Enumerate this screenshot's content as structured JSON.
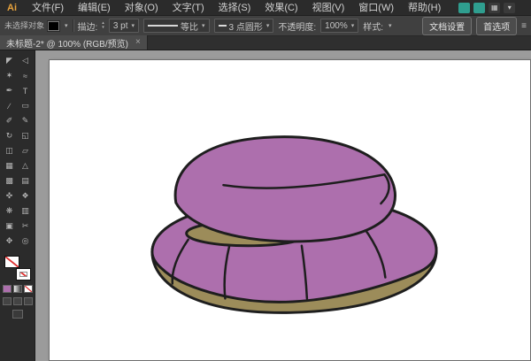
{
  "app": {
    "logo": "Ai"
  },
  "menubar": {
    "items": [
      "文件(F)",
      "编辑(E)",
      "对象(O)",
      "文字(T)",
      "选择(S)",
      "效果(C)",
      "视图(V)",
      "窗口(W)",
      "帮助(H)"
    ],
    "right_icons": [
      {
        "name": "appbar-teal-icon-1",
        "glyph": "",
        "color": "#2f9e8f"
      },
      {
        "name": "appbar-teal-icon-2",
        "glyph": "",
        "color": "#2f9e8f"
      },
      {
        "name": "arrange-documents-icon",
        "glyph": "▦",
        "color": "#3a3a3a"
      },
      {
        "name": "workspace-caret-icon",
        "glyph": "▾",
        "color": "#3a3a3a"
      }
    ]
  },
  "controlbar": {
    "no_selection": "未选择对象",
    "fill_swatch_color": "#000000",
    "stroke_label": "描边:",
    "stroke_value": "3 pt",
    "spinner_up": "▴",
    "spinner_down": "▾",
    "width_profile_label": "等比",
    "brush_label": "3 点圆形",
    "opacity_label": "不透明度:",
    "opacity_value": "100%",
    "style_label": "样式:",
    "caret": "▾",
    "doc_setup_button": "文档设置",
    "preferences_button": "首选项",
    "panel_icon": "≡"
  },
  "tabbar": {
    "title": "未标题-2* @ 100% (RGB/预览)",
    "close": "×"
  },
  "toolbar": {
    "tools": [
      {
        "name": "selection-tool",
        "glyph": "◤"
      },
      {
        "name": "direct-selection-tool",
        "glyph": "◁"
      },
      {
        "name": "magic-wand-tool",
        "glyph": "✶"
      },
      {
        "name": "lasso-tool",
        "glyph": "≈"
      },
      {
        "name": "pen-tool",
        "glyph": "✒"
      },
      {
        "name": "type-tool",
        "glyph": "T"
      },
      {
        "name": "line-segment-tool",
        "glyph": "∕"
      },
      {
        "name": "rectangle-tool",
        "glyph": "▭"
      },
      {
        "name": "paintbrush-tool",
        "glyph": "✐"
      },
      {
        "name": "pencil-tool",
        "glyph": "✎"
      },
      {
        "name": "rotate-tool",
        "glyph": "↻"
      },
      {
        "name": "scale-tool",
        "glyph": "◱"
      },
      {
        "name": "width-tool",
        "glyph": "◫"
      },
      {
        "name": "free-transform-tool",
        "glyph": "▱"
      },
      {
        "name": "shape-builder-tool",
        "glyph": "▦"
      },
      {
        "name": "perspective-grid-tool",
        "glyph": "△"
      },
      {
        "name": "mesh-tool",
        "glyph": "▩"
      },
      {
        "name": "gradient-tool",
        "glyph": "▤"
      },
      {
        "name": "eyedropper-tool",
        "glyph": "✜"
      },
      {
        "name": "blend-tool",
        "glyph": "❖"
      },
      {
        "name": "symbol-sprayer-tool",
        "glyph": "❋"
      },
      {
        "name": "column-graph-tool",
        "glyph": "▥"
      },
      {
        "name": "artboard-tool",
        "glyph": "▣"
      },
      {
        "name": "slice-tool",
        "glyph": "✂"
      },
      {
        "name": "hand-tool",
        "glyph": "✥"
      },
      {
        "name": "zoom-tool",
        "glyph": "◎"
      }
    ],
    "none_slash_color": "#e03636",
    "color_button_color": "#ad6fad"
  },
  "artwork": {
    "body_color": "#ad6fad",
    "base_color": "#9c8c5a",
    "outline_color": "#1e1e1e"
  }
}
